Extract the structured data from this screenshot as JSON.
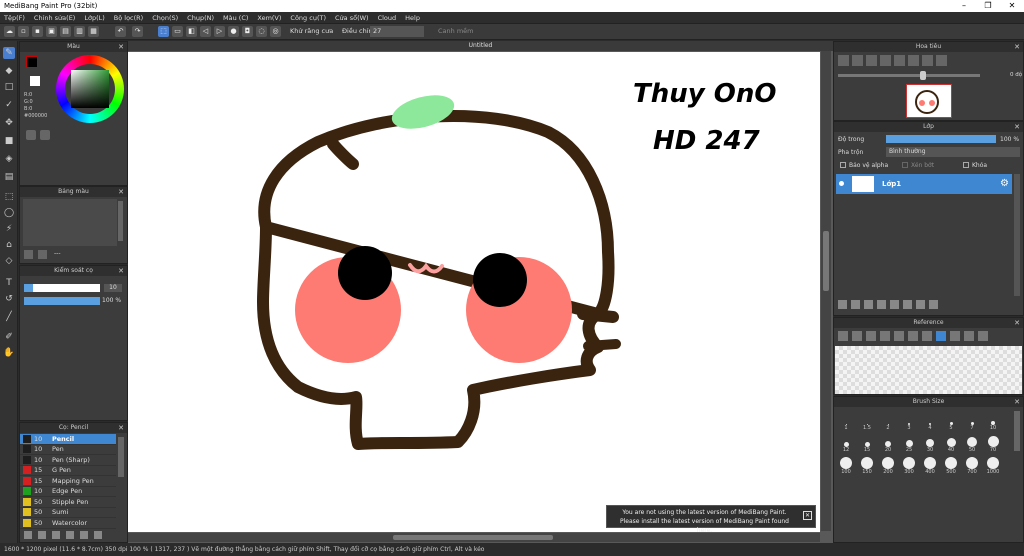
{
  "app": {
    "title": "MediBang Paint Pro (32bit)"
  },
  "menu": [
    "Tệp(F)",
    "Chỉnh sửa(E)",
    "Lớp(L)",
    "Bộ lọc(R)",
    "Chọn(S)",
    "Chụp(N)",
    "Màu (C)",
    "Xem(V)",
    "Công cụ(T)",
    "Cửa sổ(W)",
    "Cloud",
    "Help"
  ],
  "toolbar": {
    "antialias_label": "Khử răng cưa",
    "correction_label": "Điều chỉnh",
    "correction_value": "27",
    "snap_label": "Canh mềm"
  },
  "color_panel": {
    "title": "Màu",
    "r": "R:0",
    "g": "G:0",
    "b": "B:0",
    "hex": "#000000"
  },
  "palette_panel": {
    "title": "Bảng màu",
    "dash": "---"
  },
  "brush_control": {
    "title": "Kiểm soát cọ",
    "size": "10",
    "opacity": "100 %"
  },
  "brush_list": {
    "title": "Cọ: Pencil",
    "items": [
      {
        "size": "10",
        "name": "Pencil",
        "color": "#1e1e1e",
        "selected": true
      },
      {
        "size": "10",
        "name": "Pen",
        "color": "#1e1e1e"
      },
      {
        "size": "10",
        "name": "Pen (Sharp)",
        "color": "#1e1e1e"
      },
      {
        "size": "15",
        "name": "G Pen",
        "color": "#d42020"
      },
      {
        "size": "15",
        "name": "Mapping Pen",
        "color": "#d42020"
      },
      {
        "size": "10",
        "name": "Edge Pen",
        "color": "#20a020"
      },
      {
        "size": "50",
        "name": "Stipple Pen",
        "color": "#e0c020"
      },
      {
        "size": "50",
        "name": "Sumi",
        "color": "#e0c020"
      },
      {
        "size": "50",
        "name": "Watercolor",
        "color": "#e0c020"
      }
    ]
  },
  "canvas": {
    "tab": "Untitled",
    "text_line1": "Thuy OnO",
    "text_line2": "HD 247"
  },
  "notice": {
    "line1": "You are not using the latest version of MediBang Paint.",
    "line2": "Please install the latest version of MediBang Paint found here."
  },
  "navigator": {
    "title": "Hoa tiêu",
    "zoom": "0 độ"
  },
  "layer_panel": {
    "title": "Lớp",
    "opacity_label": "Độ trong",
    "opacity_value": "100 %",
    "blend_label": "Pha trộn",
    "blend_value": "Bình thường",
    "protect_alpha": "Bảo vệ alpha",
    "clipping": "Xén bớt",
    "lock": "Khóa",
    "layers": [
      {
        "name": "Lớp1"
      }
    ]
  },
  "reference": {
    "title": "Reference"
  },
  "brush_size": {
    "title": "Brush Size",
    "row1": [
      "1",
      "1.5",
      "2",
      "3",
      "4",
      "5",
      "7",
      "10"
    ],
    "row2": [
      "12",
      "15",
      "20",
      "25",
      "30",
      "40",
      "50",
      "70"
    ],
    "row3": [
      "100",
      "150",
      "200",
      "300",
      "400",
      "500",
      "700",
      "1000"
    ]
  },
  "status": {
    "text": "1600 * 1200 pixel   (11.6 * 8.7cm)   350 dpi   100 %   ( 1317, 237 )   Vẽ một đường thẳng bằng cách giữ phím Shift, Thay đổi cỡ cọ bằng cách giữ phím Ctrl, Alt và kéo"
  }
}
